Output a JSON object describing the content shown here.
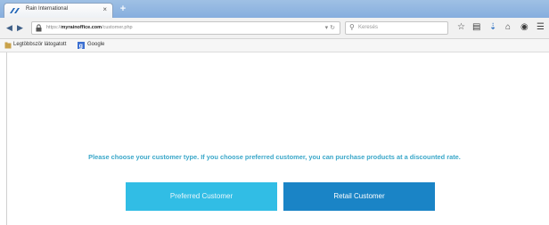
{
  "browser": {
    "tab": {
      "title": "Rain International",
      "close_glyph": "×",
      "favicon": "rain-logo-icon"
    },
    "new_tab_glyph": "+",
    "url": {
      "prefix": "https://",
      "domain": "myrainoffice.com",
      "path": "/customer.php"
    },
    "search": {
      "placeholder": "Keresés"
    },
    "bookmarks": [
      {
        "label": "Legtöbbször látogatott",
        "icon": "bookmark-folder-icon"
      },
      {
        "label": "Google",
        "icon": "google-icon"
      }
    ],
    "toolbar_icons": [
      "star-icon",
      "clipboard-icon",
      "download-icon",
      "home-icon",
      "pocket-icon",
      "menu-icon"
    ]
  },
  "main": {
    "message": "Please choose your customer type. If you choose preferred customer, you can purchase products at a discounted rate.",
    "buttons": {
      "preferred_label": "Preferred Customer",
      "retail_label": "Retail Customer"
    }
  },
  "colors": {
    "message_text": "#3aa7c9",
    "preferred_bg": "#31bde5",
    "retail_bg": "#1a84c6"
  }
}
